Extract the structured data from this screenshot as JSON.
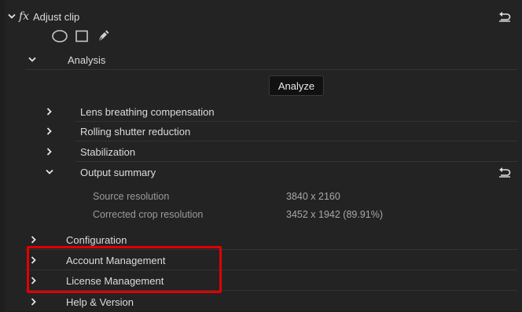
{
  "effect": {
    "fx_symbol": "fx",
    "title": "Adjust clip",
    "reset_icon": "reset-icon"
  },
  "mask_tools": {
    "icons": [
      "ellipse-mask-icon",
      "rectangle-mask-icon",
      "pen-mask-icon"
    ]
  },
  "analysis": {
    "label": "Analysis",
    "analyze_button": "Analyze",
    "items": [
      {
        "label": "Lens breathing compensation"
      },
      {
        "label": "Rolling shutter reduction"
      },
      {
        "label": "Stabilization"
      }
    ],
    "output_summary": {
      "label": "Output summary",
      "rows": [
        {
          "label": "Source resolution",
          "value": "3840 x 2160"
        },
        {
          "label": "Corrected crop resolution",
          "value": "3452 x 1942 (89.91%)"
        }
      ]
    }
  },
  "sections": [
    {
      "label": "Configuration"
    },
    {
      "label": "Account Management"
    },
    {
      "label": "License Management"
    },
    {
      "label": "Help & Version"
    }
  ],
  "colors": {
    "background": "#232323",
    "highlight_box": "#e00000"
  }
}
